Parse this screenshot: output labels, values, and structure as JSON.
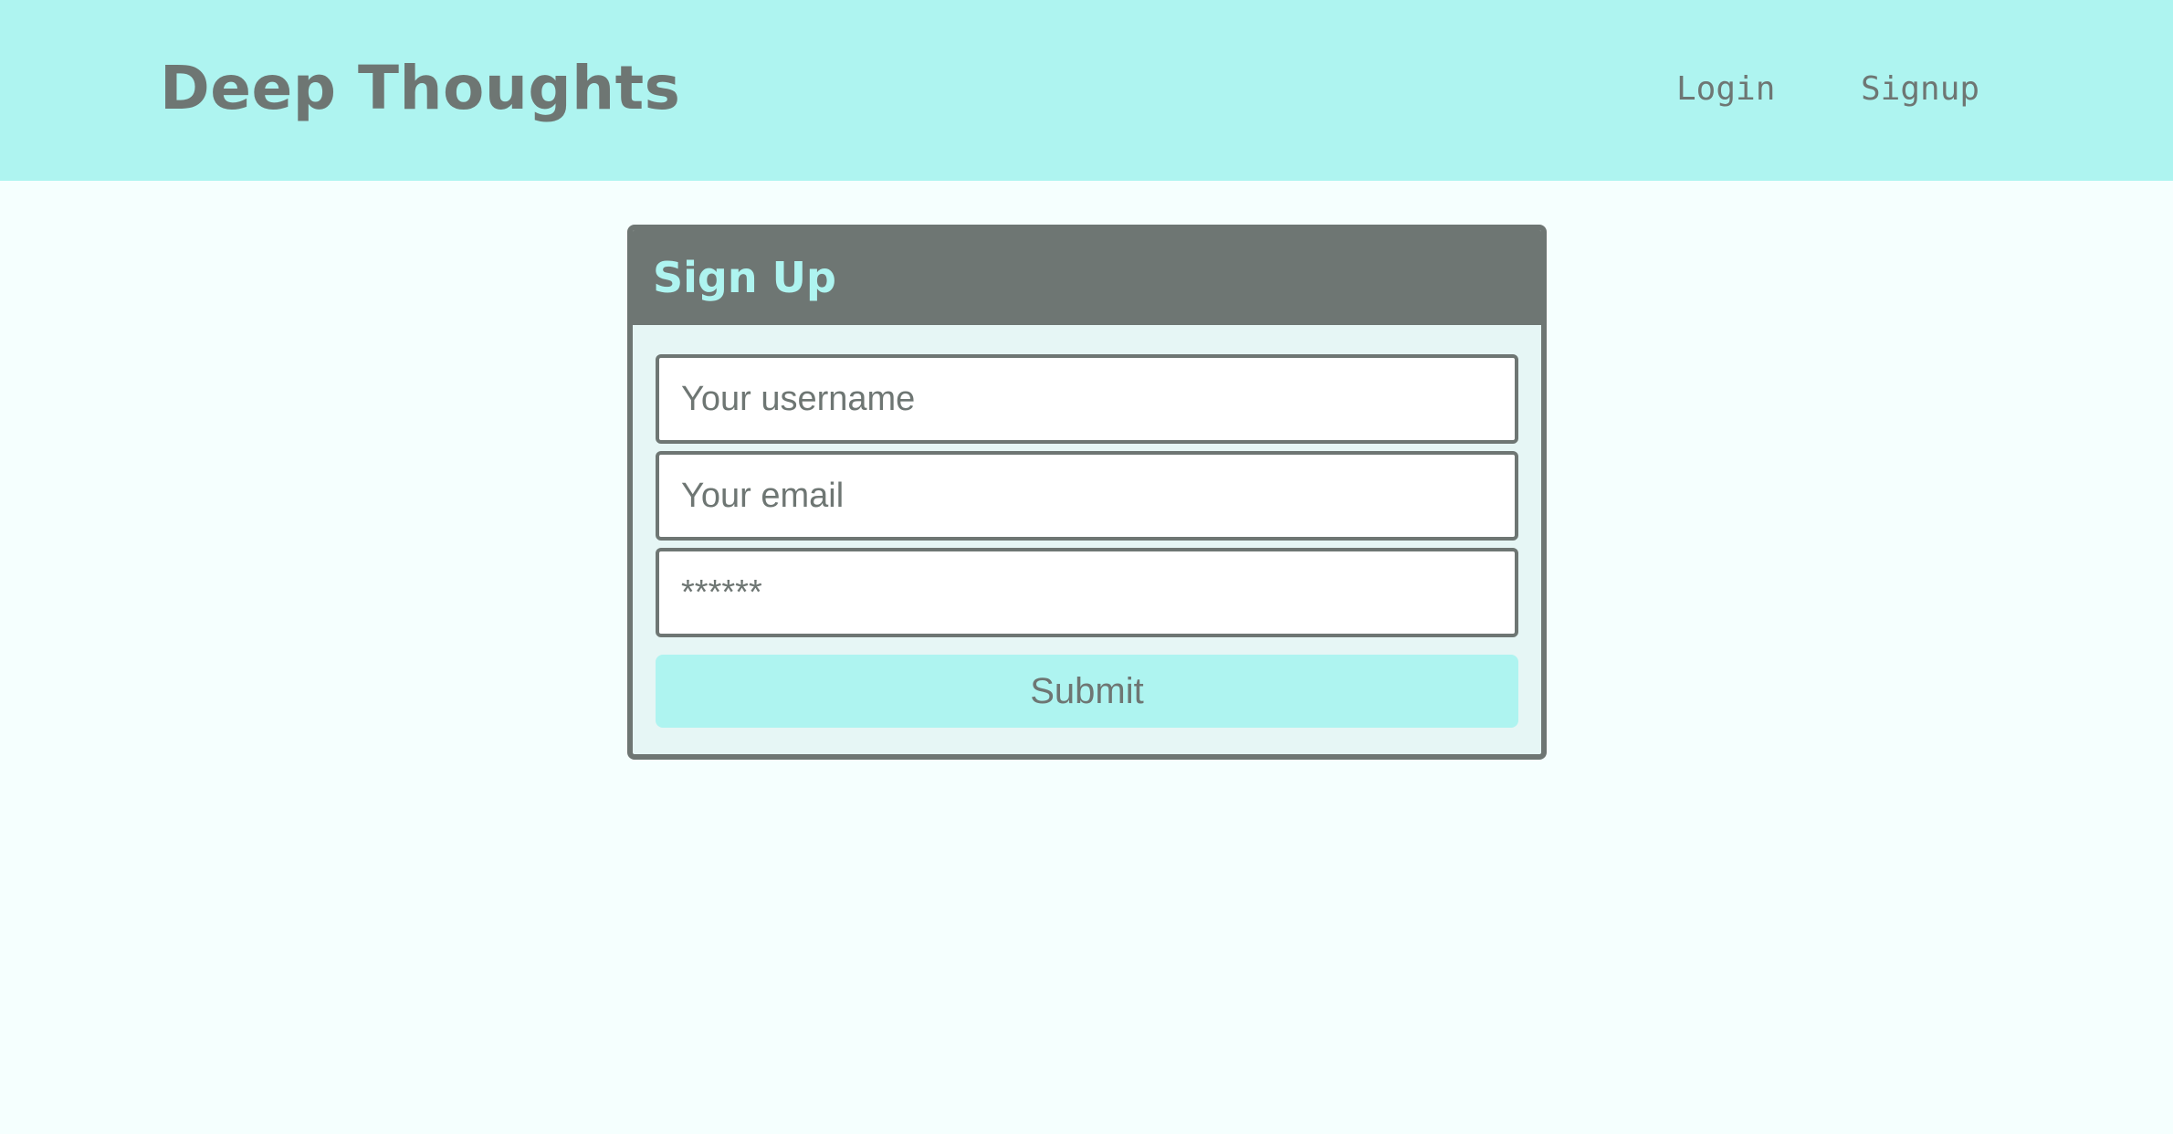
{
  "header": {
    "brand": "Deep Thoughts",
    "nav": {
      "login": "Login",
      "signup": "Signup"
    }
  },
  "signup_form": {
    "title": "Sign Up",
    "username_placeholder": "Your username",
    "email_placeholder": "Your email",
    "password_placeholder": "******",
    "submit_label": "Submit"
  },
  "colors": {
    "header_background": "#aef4f0",
    "page_background": "#f5fffe",
    "text_gray": "#6e7673",
    "card_background": "#e6f6f5",
    "accent_cyan": "#aef4f0"
  }
}
